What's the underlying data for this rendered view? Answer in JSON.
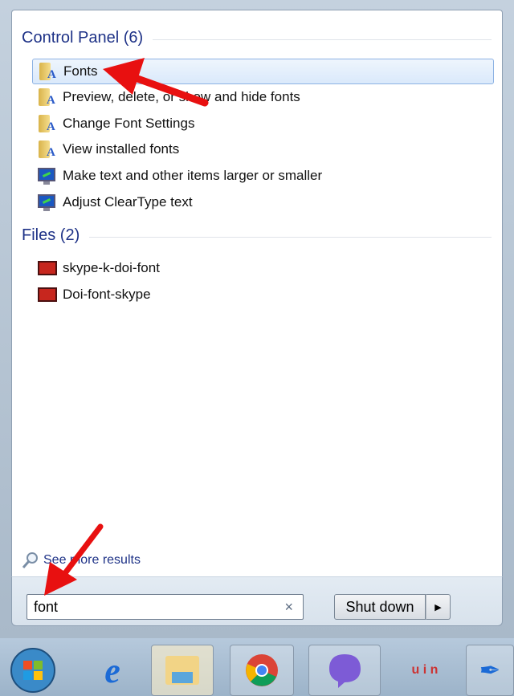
{
  "control_panel": {
    "header": "Control Panel (6)",
    "items": [
      {
        "label": "Fonts",
        "icon": "fonts-folder-icon"
      },
      {
        "label": "Preview, delete, or show and hide fonts",
        "icon": "fonts-folder-icon"
      },
      {
        "label": "Change Font Settings",
        "icon": "fonts-folder-icon"
      },
      {
        "label": "View installed fonts",
        "icon": "fonts-folder-icon"
      },
      {
        "label": "Make text and other items larger or smaller",
        "icon": "display-icon"
      },
      {
        "label": "Adjust ClearType text",
        "icon": "display-icon"
      }
    ]
  },
  "files": {
    "header": "Files (2)",
    "items": [
      {
        "label": "skype-k-doi-font",
        "icon": "video-file-icon"
      },
      {
        "label": "Doi-font-skype",
        "icon": "video-file-icon"
      }
    ]
  },
  "see_more": "See more results",
  "search": {
    "value": "font",
    "clear": "×"
  },
  "shutdown": {
    "label": "Shut down",
    "arrow": "▶"
  },
  "colors": {
    "header": "#1e3287",
    "annotation_arrow": "#e81010",
    "selection": "#dae9fb"
  }
}
